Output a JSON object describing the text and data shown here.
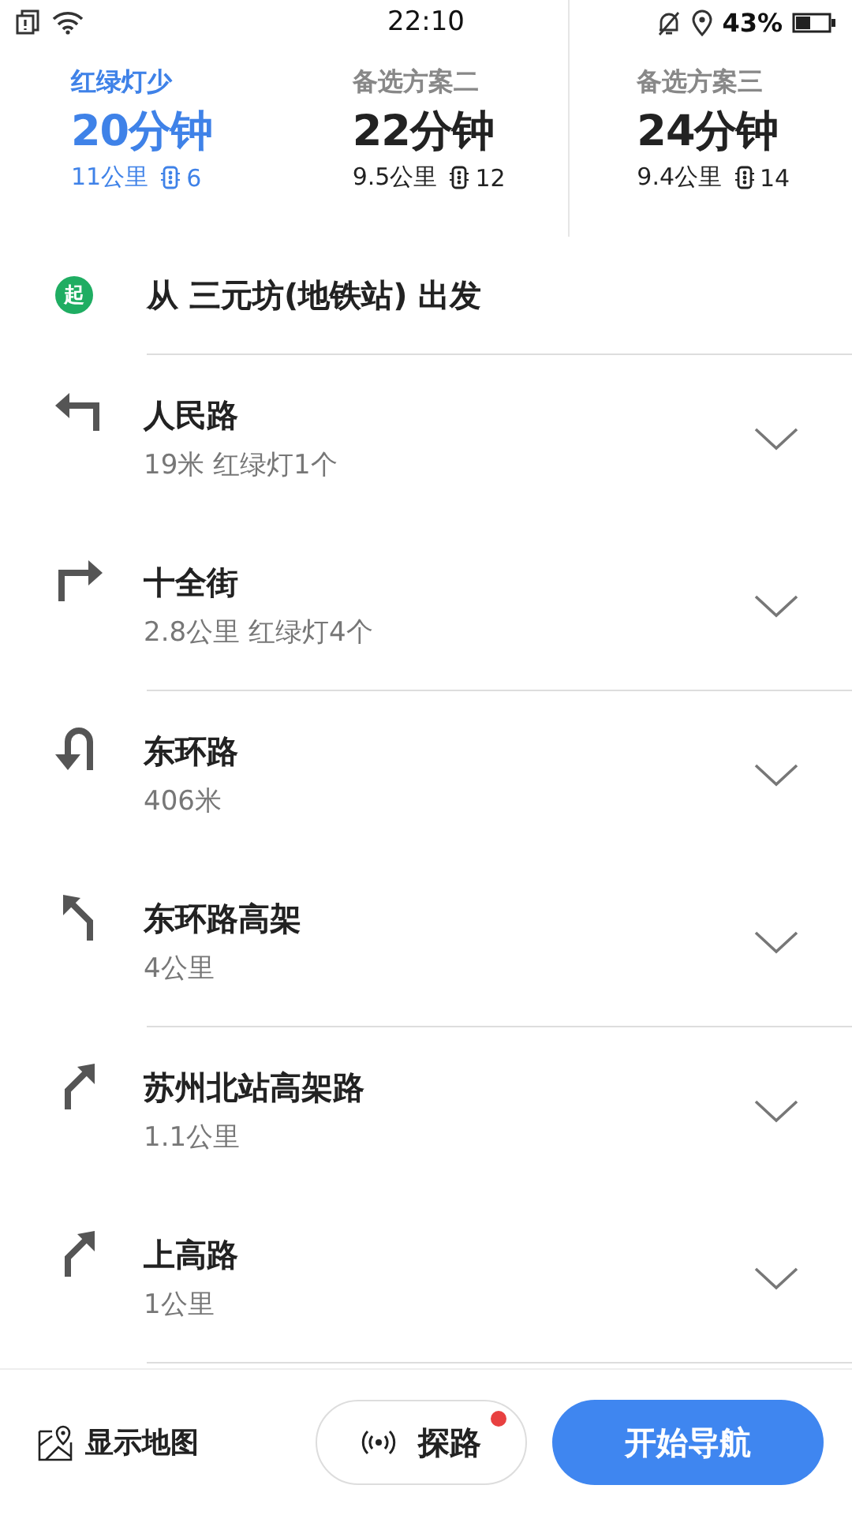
{
  "status_bar": {
    "time": "22:10",
    "battery": "43%"
  },
  "routes": [
    {
      "label": "红绿灯少",
      "duration": "20分钟",
      "distance": "11公里",
      "lights": "6",
      "selected": true
    },
    {
      "label": "备选方案二",
      "duration": "22分钟",
      "distance": "9.5公里",
      "lights": "12",
      "selected": false
    },
    {
      "label": "备选方案三",
      "duration": "24分钟",
      "distance": "9.4公里",
      "lights": "14",
      "selected": false
    }
  ],
  "start": {
    "badge": "起",
    "text": "从 三元坊(地铁站) 出发"
  },
  "step_groups": [
    {
      "steps": [
        {
          "kind": "left",
          "road": "人民路",
          "detail": "19米 红绿灯1个"
        },
        {
          "kind": "right",
          "road": "十全街",
          "detail": "2.8公里 红绿灯4个"
        }
      ]
    },
    {
      "steps": [
        {
          "kind": "uturn",
          "road": "东环路",
          "detail": "406米"
        },
        {
          "kind": "slightleft",
          "road": "东环路高架",
          "detail": "4公里"
        }
      ]
    },
    {
      "steps": [
        {
          "kind": "slightright",
          "road": "苏州北站高架路",
          "detail": "1.1公里"
        },
        {
          "kind": "slightright",
          "road": "上高路",
          "detail": "1公里"
        }
      ]
    }
  ],
  "bottom_bar": {
    "map_label": "显示地图",
    "explore_label": "探路",
    "explore_notification": true,
    "navigate_label": "开始导航"
  }
}
